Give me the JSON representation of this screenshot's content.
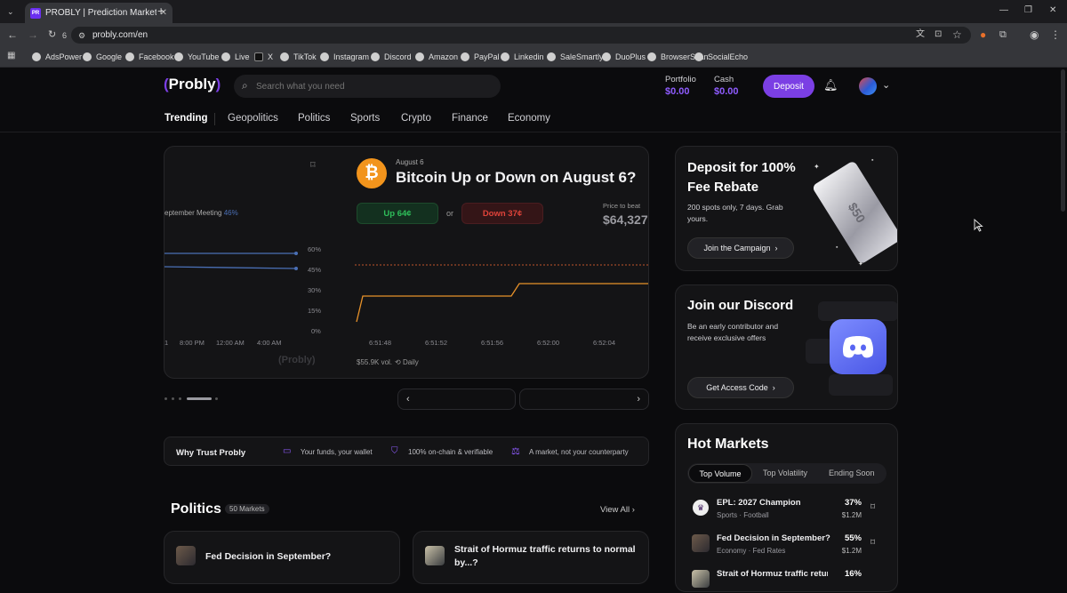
{
  "browser": {
    "tab_title": "PROBLY | Prediction Markets M",
    "tab_favicon_text": "PR",
    "url": "probly.com/en",
    "reload_count": "6",
    "bookmarks": [
      "AdsPower",
      "Google",
      "Facebook",
      "YouTube",
      "Live",
      "X",
      "TikTok",
      "Instagram",
      "Discord",
      "Amazon",
      "PayPal",
      "Linkedin",
      "SaleSmartly",
      "DuoPlus",
      "BrowserScan",
      "SocialEcho"
    ]
  },
  "header": {
    "logo": "Probly",
    "search_placeholder": "Search what you need",
    "portfolio_label": "Portfolio",
    "portfolio_value": "$0.00",
    "cash_label": "Cash",
    "cash_value": "$0.00",
    "deposit_label": "Deposit"
  },
  "nav": [
    "Trending",
    "Geopolitics",
    "Politics",
    "Sports",
    "Crypto",
    "Finance",
    "Economy"
  ],
  "hero_left": {
    "legend_text": "eptember Meeting",
    "legend_pct": "46%",
    "y_ticks": [
      "60%",
      "45%",
      "30%",
      "15%",
      "0%"
    ],
    "x_ticks": [
      "1",
      "8:00 PM",
      "12:00 AM",
      "4:00 AM"
    ],
    "watermark": "Probly"
  },
  "hero_main": {
    "date": "August 6",
    "title": "Bitcoin Up or Down on August 6?",
    "up_label": "Up 64¢",
    "or_text": "or",
    "down_label": "Down 37¢",
    "price_label": "Price to beat",
    "price_value": "$64,327.",
    "x_ticks": [
      "6:51:48",
      "6:51:52",
      "6:51:56",
      "6:52:00",
      "6:52:04"
    ],
    "volume": "$55.9K vol.",
    "frequency": "Daily"
  },
  "promo_deposit": {
    "title": "Deposit for 100% Fee Rebate",
    "subtitle": "200 spots only, 7 days. Grab yours.",
    "cta": "Join the Campaign",
    "ticket_text": "$50"
  },
  "promo_discord": {
    "title": "Join our Discord",
    "subtitle": "Be an early contributor and receive exclusive offers",
    "cta": "Get Access Code"
  },
  "trust": {
    "title": "Why Trust Probly",
    "items": [
      "Your funds, your wallet",
      "100% on-chain & verifiable",
      "A market, not your counterparty"
    ]
  },
  "politics": {
    "title": "Politics",
    "count": "50 Markets",
    "view_all": "View All",
    "cards": [
      "Fed Decision in September?",
      "Strait of Hormuz traffic returns to normal by...?"
    ]
  },
  "hot_markets": {
    "title": "Hot Markets",
    "tabs": [
      "Top Volume",
      "Top Volatility",
      "Ending Soon"
    ],
    "rows": [
      {
        "title": "EPL: 2027 Champion",
        "sub": "Sports · Football",
        "pct": "37%",
        "vol": "$1.2M"
      },
      {
        "title": "Fed Decision in September?",
        "sub": "Economy · Fed Rates",
        "pct": "55%",
        "vol": "$1.2M"
      },
      {
        "title": "Strait of Hormuz traffic return",
        "sub": "",
        "pct": "16%",
        "vol": ""
      }
    ]
  },
  "colors": {
    "accent": "#7b3fe4",
    "up": "#2fbf5a",
    "down": "#e0433a",
    "chart_line": "#e8922a",
    "chart_blue": "#4a6fb5"
  }
}
